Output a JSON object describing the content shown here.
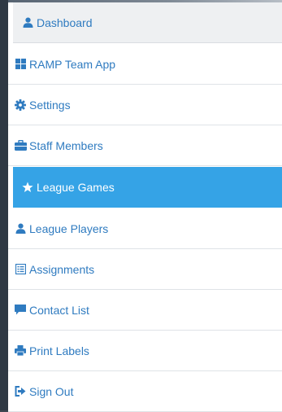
{
  "sidebar": {
    "items": [
      {
        "label": "Dashboard",
        "icon": "user-icon"
      },
      {
        "label": "RAMP Team App",
        "icon": "grid-icon"
      },
      {
        "label": "Settings",
        "icon": "gear-icon"
      },
      {
        "label": "Staff Members",
        "icon": "briefcase-icon"
      },
      {
        "label": "League Games",
        "icon": "star-icon"
      },
      {
        "label": "League Players",
        "icon": "user-icon"
      },
      {
        "label": "Assignments",
        "icon": "list-icon"
      },
      {
        "label": "Contact List",
        "icon": "comment-icon"
      },
      {
        "label": "Print Labels",
        "icon": "print-icon"
      },
      {
        "label": "Sign Out",
        "icon": "sign-out-icon"
      }
    ],
    "active_index": 4,
    "colors": {
      "link": "#2f7bc0",
      "active_bg": "#35a3e6",
      "active_text": "#ffffff",
      "header_bg": "#eef0f2"
    }
  }
}
